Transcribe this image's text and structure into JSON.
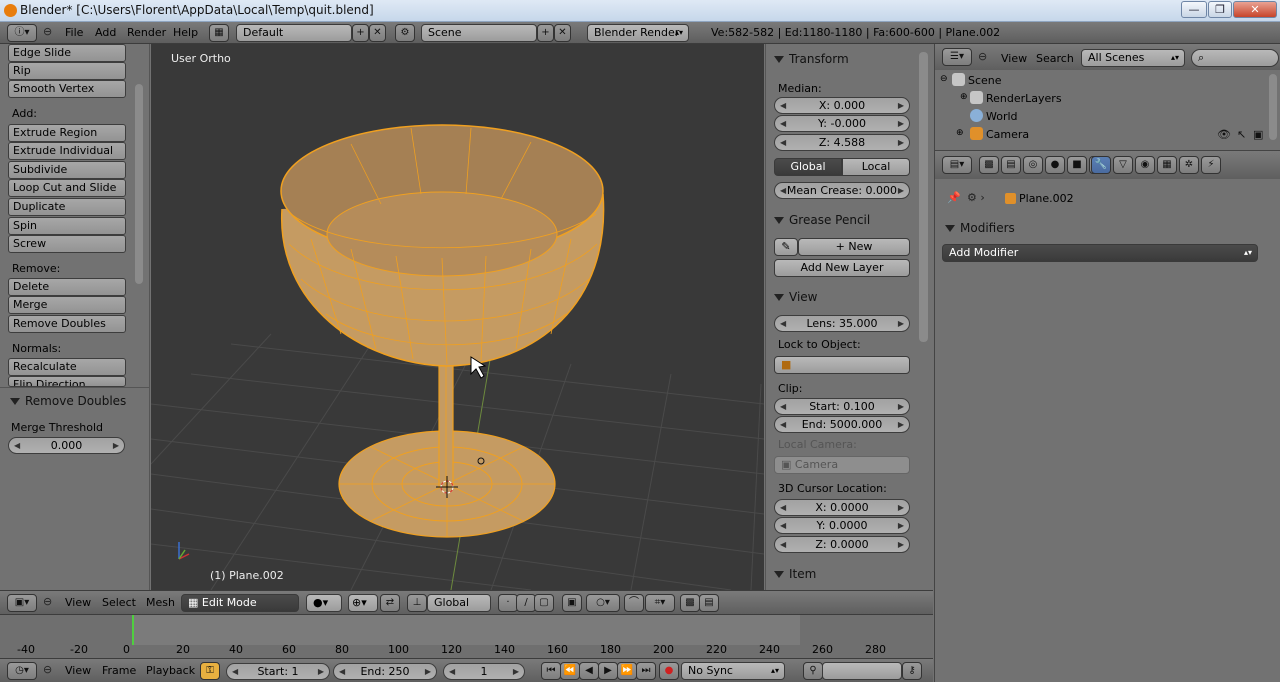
{
  "window": {
    "title": "Blender* [C:\\Users\\Florent\\AppData\\Local\\Temp\\quit.blend]",
    "buttons": [
      "—",
      "❐",
      "✕"
    ]
  },
  "infobar": {
    "menus": [
      "File",
      "Add",
      "Render",
      "Help"
    ],
    "layout": "Default",
    "scene": "Scene",
    "engine": "Blender Render",
    "stats": "Ve:582-582 | Ed:1180-1180 | Fa:600-600 | Plane.002"
  },
  "toolshelf": {
    "top_buttons": [
      "Edge Slide",
      "Rip",
      "Smooth Vertex"
    ],
    "add_label": "Add:",
    "add_buttons": [
      "Extrude Region",
      "Extrude Individual",
      "Subdivide",
      "Loop Cut and Slide",
      "Duplicate",
      "Spin",
      "Screw"
    ],
    "remove_label": "Remove:",
    "remove_buttons": [
      "Delete",
      "Merge",
      "Remove Doubles"
    ],
    "normals_label": "Normals:",
    "normals_buttons": [
      "Recalculate",
      "Flip Direction"
    ],
    "operator_panel": "Remove Doubles",
    "merge_threshold_label": "Merge Threshold",
    "merge_threshold_value": "0.000"
  },
  "viewport": {
    "view_label": "User Ortho",
    "object_label": "(1) Plane.002"
  },
  "npanel": {
    "transform": {
      "title": "Transform",
      "median_label": "Median:",
      "x": "X: 0.000",
      "y": "Y: -0.000",
      "z": "Z: 4.588",
      "global": "Global",
      "local": "Local",
      "mean_crease": "Mean Crease: 0.000"
    },
    "grease_pencil": {
      "title": "Grease Pencil",
      "new": "New",
      "add_layer": "Add New Layer"
    },
    "view": {
      "title": "View",
      "lens": "Lens: 35.000",
      "lock_label": "Lock to Object:",
      "clip_label": "Clip:",
      "clip_start": "Start: 0.100",
      "clip_end": "End: 5000.000",
      "local_camera_label": "Local Camera:",
      "camera": "Camera",
      "cursor_label": "3D Cursor Location:",
      "cx": "X: 0.0000",
      "cy": "Y: 0.0000",
      "cz": "Z: 0.0000"
    },
    "item": {
      "title": "Item"
    }
  },
  "v3dheader": {
    "menus": [
      "View",
      "Select",
      "Mesh"
    ],
    "mode": "Edit Mode",
    "orientation": "Global"
  },
  "timeline": {
    "ticks": [
      "-40",
      "-20",
      "0",
      "20",
      "40",
      "60",
      "80",
      "100",
      "120",
      "140",
      "160",
      "180",
      "200",
      "220",
      "240",
      "260",
      "280"
    ],
    "current_frame_marker": 1
  },
  "tlheader": {
    "menus": [
      "View",
      "Frame",
      "Playback"
    ],
    "start": "Start: 1",
    "end": "End: 250",
    "frame": "1",
    "sync": "No Sync"
  },
  "outliner": {
    "menus": [
      "View",
      "Search"
    ],
    "scenes": "All Scenes",
    "items": [
      "Scene",
      "RenderLayers",
      "World",
      "Camera"
    ]
  },
  "properties": {
    "breadcrumb": "Plane.002",
    "panel_title": "Modifiers",
    "add_modifier": "Add Modifier"
  }
}
